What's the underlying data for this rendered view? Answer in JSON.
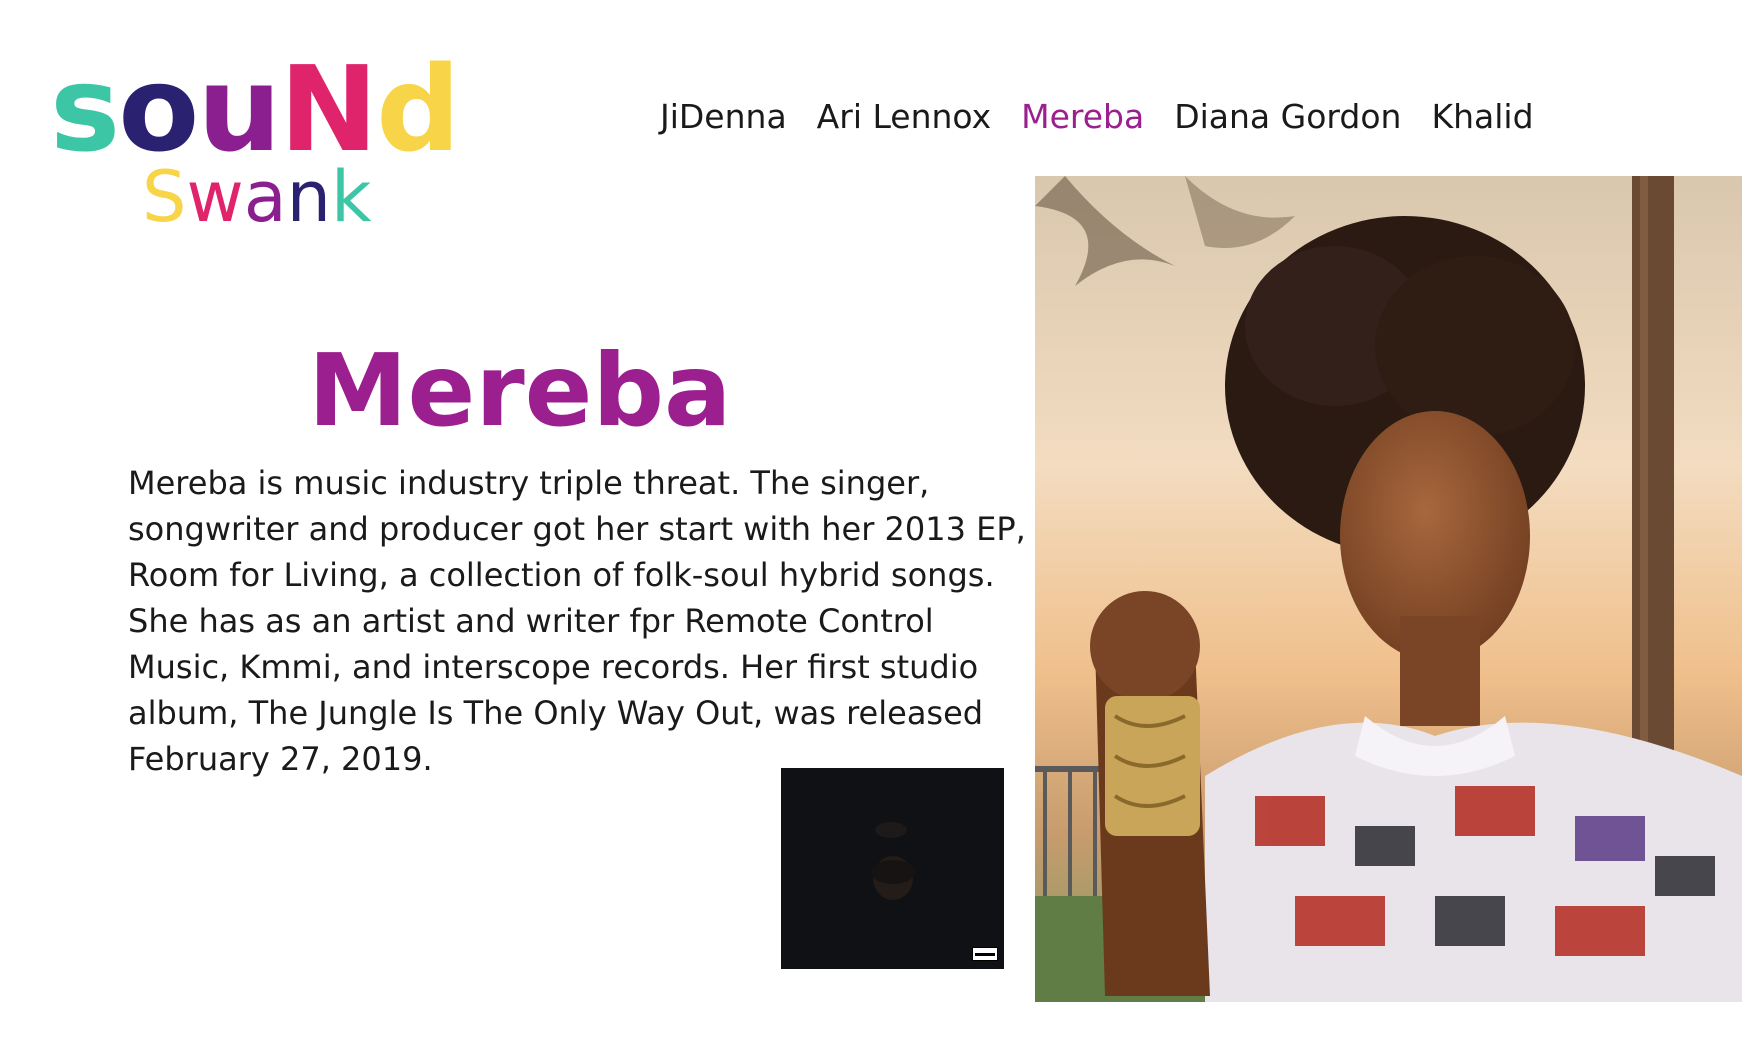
{
  "logo": {
    "word": {
      "letters": [
        {
          "char": "s",
          "color": "#3cc6a6"
        },
        {
          "char": "o",
          "color": "#2a2170"
        },
        {
          "char": "u",
          "color": "#8b1f8f"
        },
        {
          "char": "N",
          "color": "#e0246c"
        },
        {
          "char": "d",
          "color": "#f7d448"
        }
      ]
    },
    "sub": {
      "letters": [
        {
          "char": "S",
          "color": "#f7d448"
        },
        {
          "char": "w",
          "color": "#e0246c"
        },
        {
          "char": "a",
          "color": "#8b1f8f"
        },
        {
          "char": "n",
          "color": "#2a2170"
        },
        {
          "char": "k",
          "color": "#3cc6a6"
        }
      ]
    }
  },
  "nav": {
    "items": [
      {
        "label": "JiDenna",
        "active": false
      },
      {
        "label": "Ari Lennox",
        "active": false
      },
      {
        "label": "Mereba",
        "active": true
      },
      {
        "label": "Diana Gordon",
        "active": false
      },
      {
        "label": "Khalid",
        "active": false
      }
    ]
  },
  "artist": {
    "name": "Mereba",
    "bio": "Mereba is music industry triple threat. The singer, songwriter and producer got her start with her 2013 EP, Room for Living, a collection of folk-soul hybrid songs. She has as an artist and writer fpr Remote Control Music, Kmmi, and interscope records. Her first studio album, The Jungle Is The Only Way Out, was released February 27, 2019."
  },
  "colors": {
    "accent": "#9b1f8e",
    "text": "#1a1a1a",
    "background": "#ffffff",
    "album_bg": "#0f1114"
  },
  "media": {
    "hero_image": "artist-portrait",
    "album_cover": "album-cover",
    "advisory_icon": "parental-advisory-icon"
  }
}
